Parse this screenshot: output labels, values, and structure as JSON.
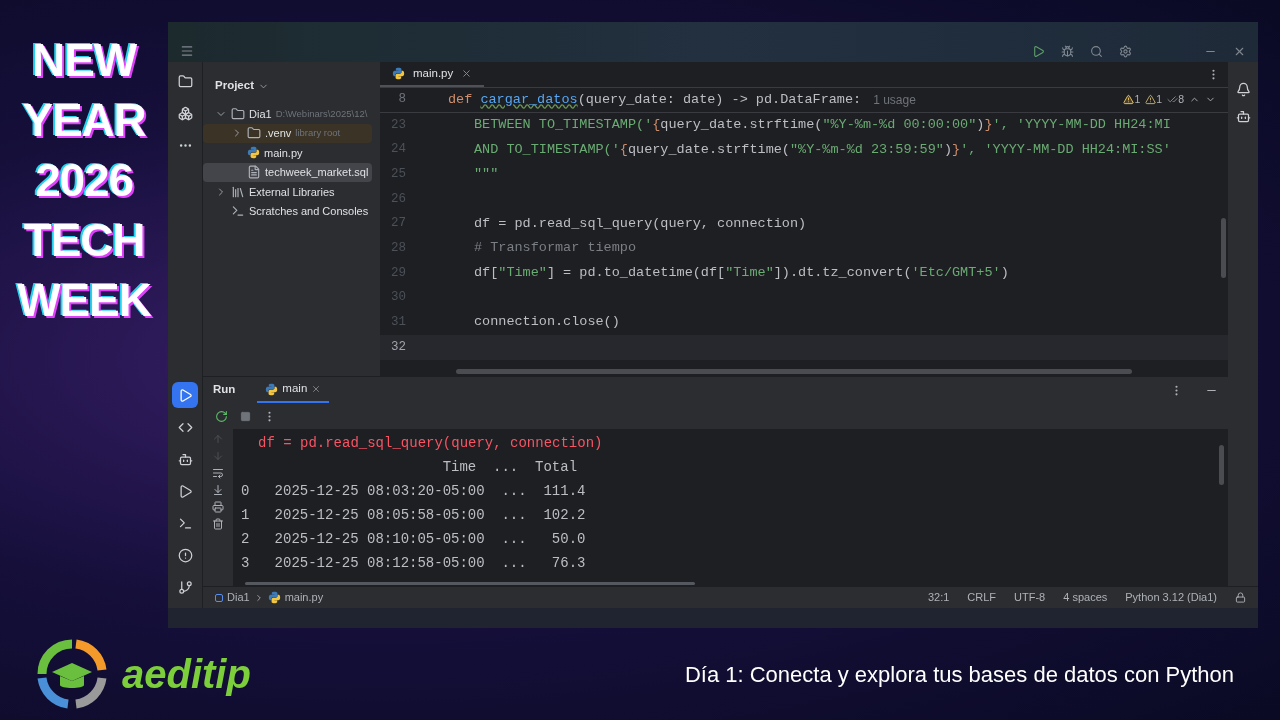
{
  "banner": {
    "lines": [
      "NEW",
      "YEAR",
      "2026",
      "TECH",
      "WEEK"
    ]
  },
  "project_panel": {
    "title": "Project",
    "tree": [
      {
        "label": "Dia1",
        "hint": "D:\\Webinars\\2025\\12\\",
        "kind": "folder",
        "expanded": true,
        "selected": false,
        "children": [
          {
            "label": ".venv",
            "hint": "library root",
            "kind": "folder",
            "expanded": false,
            "selected": false
          },
          {
            "label": "main.py",
            "kind": "python",
            "selected": false
          },
          {
            "label": "techweek_market.sql",
            "kind": "text",
            "selected": true
          }
        ]
      },
      {
        "label": "External Libraries",
        "kind": "library",
        "expanded": false,
        "selected": false
      },
      {
        "label": "Scratches and Consoles",
        "kind": "scratch",
        "selected": false
      }
    ]
  },
  "editor": {
    "tabs": [
      {
        "label": "main.py",
        "selected": true
      }
    ],
    "inspections": [
      {
        "kind": "warning",
        "count": "1"
      },
      {
        "kind": "weak",
        "count": "1"
      },
      {
        "kind": "ok",
        "count": "8"
      }
    ],
    "sticky_line": {
      "number": "8",
      "tokens": [
        {
          "t": "def ",
          "kind": "kw"
        },
        {
          "t": "cargar_datos",
          "kind": "fn"
        },
        {
          "t": "(query_date: date) -> pd.DataFrame:",
          "kind": "plain"
        }
      ],
      "hint": "1 usage"
    },
    "lines": [
      {
        "number": "23",
        "current": false,
        "tokens": [
          {
            "t": "BETWEEN TO_TIMESTAMP('",
            "kind": "str"
          },
          {
            "t": "{",
            "kind": "brace"
          },
          {
            "t": "query_date.strftime(",
            "kind": "plain"
          },
          {
            "t": "\"%Y-%m-%d 00:00:00\"",
            "kind": "str"
          },
          {
            "t": ")",
            "kind": "plain"
          },
          {
            "t": "}",
            "kind": "brace"
          },
          {
            "t": "', 'YYYY-MM-DD HH24:MI",
            "kind": "str"
          }
        ]
      },
      {
        "number": "24",
        "current": false,
        "tokens": [
          {
            "t": "AND TO_TIMESTAMP('",
            "kind": "str"
          },
          {
            "t": "{",
            "kind": "brace"
          },
          {
            "t": "query_date.strftime(",
            "kind": "plain"
          },
          {
            "t": "\"%Y-%m-%d 23:59:59\"",
            "kind": "str"
          },
          {
            "t": ")",
            "kind": "plain"
          },
          {
            "t": "}",
            "kind": "brace"
          },
          {
            "t": "', 'YYYY-MM-DD HH24:MI:SS'",
            "kind": "str"
          }
        ]
      },
      {
        "number": "25",
        "current": false,
        "tokens": [
          {
            "t": "\"\"\"",
            "kind": "str"
          }
        ]
      },
      {
        "number": "26",
        "current": false
      },
      {
        "number": "27",
        "current": false,
        "tokens": [
          {
            "t": "df = pd.read_sql_query(query, connection)",
            "kind": "plain"
          }
        ]
      },
      {
        "number": "28",
        "current": false,
        "tokens": [
          {
            "t": "# Transformar tiempo",
            "kind": "comment"
          }
        ]
      },
      {
        "number": "29",
        "current": false,
        "tokens": [
          {
            "t": "df[",
            "kind": "plain"
          },
          {
            "t": "\"Time\"",
            "kind": "str"
          },
          {
            "t": "] = pd.to_datetime(df[",
            "kind": "plain"
          },
          {
            "t": "\"Time\"",
            "kind": "str"
          },
          {
            "t": "]).dt.tz_convert(",
            "kind": "plain"
          },
          {
            "t": "'Etc/GMT+5'",
            "kind": "str"
          },
          {
            "t": ")",
            "kind": "plain"
          }
        ]
      },
      {
        "number": "30",
        "current": false
      },
      {
        "number": "31",
        "current": false,
        "tokens": [
          {
            "t": "connection.close()",
            "kind": "plain"
          }
        ]
      },
      {
        "number": "32",
        "current": true
      }
    ]
  },
  "run_panel": {
    "title": "Run",
    "tabs": [
      {
        "label": "main",
        "selected": true
      }
    ],
    "output": [
      {
        "kind": "error",
        "text": "df = pd.read_sql_query(query, connection)"
      },
      {
        "kind": "out",
        "text": "                        Time  ...  Total"
      },
      {
        "kind": "out",
        "text": "0   2025-12-25 08:03:20-05:00  ...  111.4"
      },
      {
        "kind": "out",
        "text": "1   2025-12-25 08:05:58-05:00  ...  102.2"
      },
      {
        "kind": "out",
        "text": "2   2025-12-25 08:10:05-05:00  ...   50.0"
      },
      {
        "kind": "out",
        "text": "3   2025-12-25 08:12:58-05:00  ...   76.3"
      }
    ]
  },
  "status_bar": {
    "breadcrumbs": [
      {
        "label": "Dia1",
        "kind": "module"
      },
      {
        "label": "main.py",
        "kind": "python"
      }
    ],
    "items": [
      "32:1",
      "CRLF",
      "UTF-8",
      "4 spaces",
      "Python 3.12 (Dia1)"
    ]
  },
  "footer": {
    "brand": "aeditip",
    "caption": "Día 1: Conecta y explora tus bases de datos con Python"
  }
}
